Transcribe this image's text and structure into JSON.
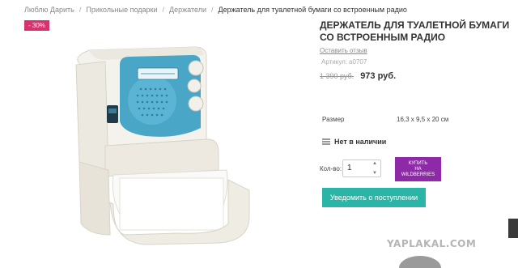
{
  "breadcrumb": {
    "items": [
      "Люблю Дарить",
      "Прикольные подарки",
      "Держатели"
    ],
    "current": "Держатель для туалетной бумаги со встроенным радио",
    "separator": "/"
  },
  "badge": {
    "discount": "- 30%"
  },
  "product": {
    "title": "ДЕРЖАТЕЛЬ ДЛЯ ТУАЛЕТНОЙ БУМАГИ СО ВСТРОЕННЫМ РАДИО",
    "review_link": "Оставить отзыв",
    "sku_label": "Артикул:",
    "sku_value": "а0707",
    "old_price": "1 390 руб.",
    "new_price": "973 руб.",
    "spec_label": "Размер",
    "spec_value": "16,3 х 9,5 х 20 см",
    "stock_status": "Нет в наличии",
    "qty_label": "Кол-во:",
    "qty_value": "1",
    "wb_button_lines": [
      "КУПИТЬ",
      "НА",
      "WILDBERRIES"
    ],
    "notify_label": "Уведомить о поступлении"
  },
  "watermark": "YAPLAKAL.COM",
  "colors": {
    "discount": "#d6336c",
    "wildberries": "#8e2aa8",
    "notify": "#2ab5a6",
    "radio_panel": "#4aa6c7"
  }
}
